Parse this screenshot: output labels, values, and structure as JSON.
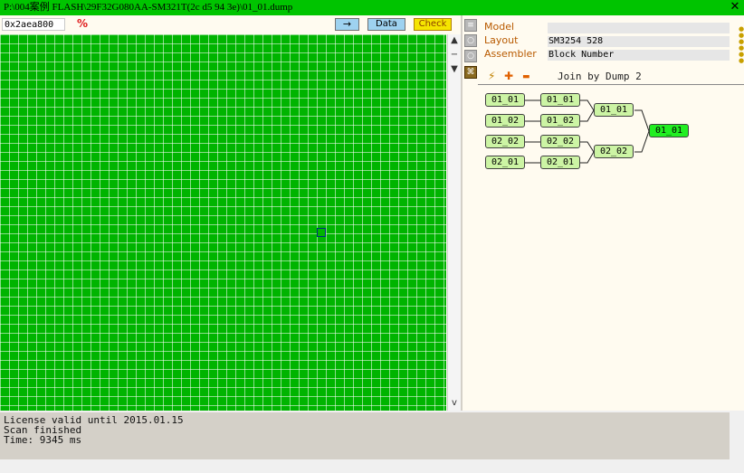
{
  "window": {
    "title": "P:\\004案例  FLASH\\29F32G080AA-SM321T(2c d5 94 3e)\\01_01.dump",
    "close_glyph": "✕"
  },
  "toolbar": {
    "address": "0x2aea800",
    "percent_glyph": "%",
    "go_label": "→",
    "data_label": "Data",
    "check_label": "Check"
  },
  "grid_scroll": {
    "up_glyph": "▲",
    "down_glyph": "▼",
    "minus_glyph": "−",
    "v_glyph": "v"
  },
  "side_icons": [
    "list-icon",
    "bulb-icon",
    "bulb-icon",
    "graph-icon"
  ],
  "properties": [
    {
      "label": "Model",
      "value": ""
    },
    {
      "label": "Layout",
      "value": "SM3254 528"
    },
    {
      "label": "Assembler",
      "value": "Block Number"
    }
  ],
  "assembler_toolbar": {
    "wand_glyph": "⚡",
    "add_glyph": "✚",
    "remove_glyph": "▬",
    "join_label": "Join by Dump 2"
  },
  "tree": {
    "col1": [
      "01_01",
      "01_02",
      "02_02",
      "02_01"
    ],
    "col2": [
      "01_01",
      "01_02",
      "02_02",
      "02_01"
    ],
    "col3": [
      "01_01",
      "02_02"
    ],
    "root": "01_01"
  },
  "log": {
    "lines": [
      "License valid until 2015.01.15",
      "Scan finished",
      "Time: 9345 ms"
    ]
  },
  "colors": {
    "title_bar": "#00c400",
    "grid": "#00b400",
    "node": "#ccf4a4",
    "root_node": "#22ee22"
  }
}
